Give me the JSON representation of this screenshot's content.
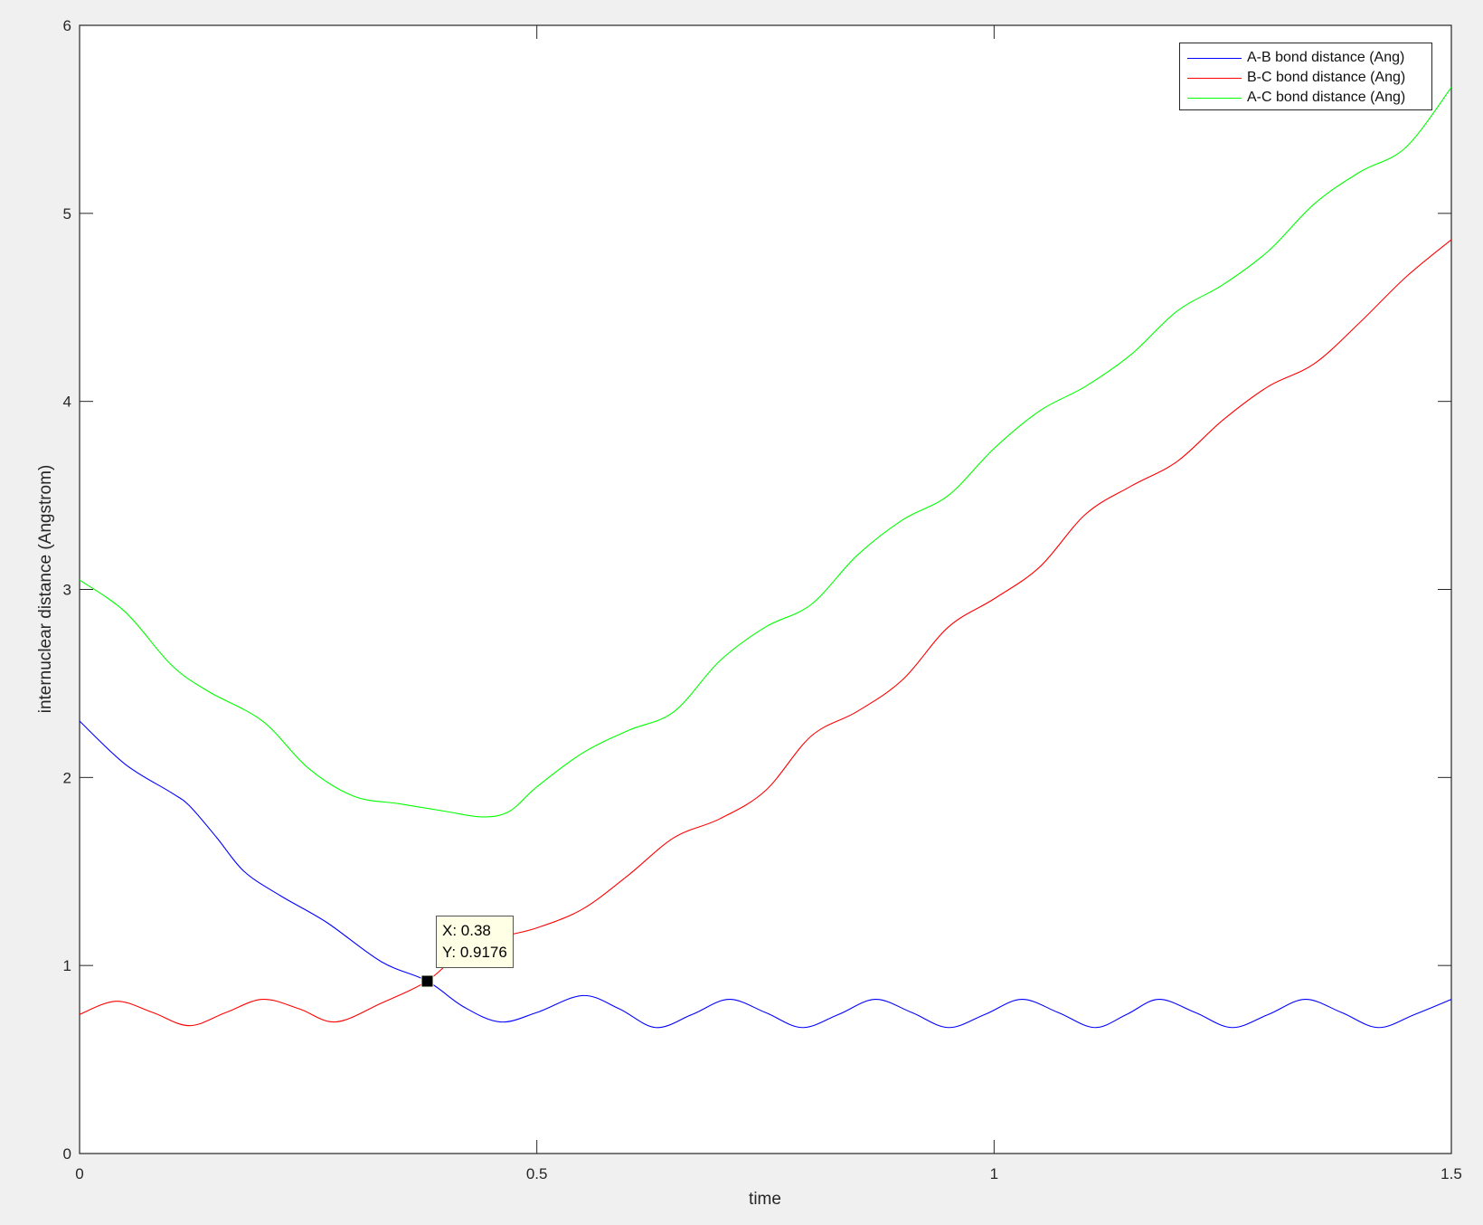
{
  "chart_data": {
    "type": "line",
    "title": "",
    "xlabel": "time",
    "ylabel": "internuclear distance (Angstrom)",
    "xlim": [
      0,
      1.5
    ],
    "ylim": [
      0,
      6
    ],
    "xticks": [
      "0",
      "0.5",
      "1",
      "1.5"
    ],
    "xtick_values": [
      0,
      0.5,
      1,
      1.5
    ],
    "yticks": [
      "0",
      "1",
      "2",
      "3",
      "4",
      "5",
      "6"
    ],
    "ytick_values": [
      0,
      1,
      2,
      3,
      4,
      5,
      6
    ],
    "grid": false,
    "legend_position": "top-right",
    "series": [
      {
        "name": "A-B bond distance (Ang)",
        "color": "#0000ff",
        "x": [
          0,
          0.05,
          0.1,
          0.12,
          0.15,
          0.18,
          0.22,
          0.27,
          0.33,
          0.38,
          0.42,
          0.46,
          0.5,
          0.55,
          0.59,
          0.63,
          0.67,
          0.71,
          0.75,
          0.79,
          0.83,
          0.87,
          0.91,
          0.95,
          0.99,
          1.03,
          1.07,
          1.11,
          1.145,
          1.18,
          1.22,
          1.26,
          1.3,
          1.34,
          1.38,
          1.42,
          1.46,
          1.5
        ],
        "y": [
          2.3,
          2.07,
          1.92,
          1.85,
          1.68,
          1.5,
          1.37,
          1.23,
          1.02,
          0.9176,
          0.78,
          0.7,
          0.75,
          0.84,
          0.77,
          0.67,
          0.74,
          0.82,
          0.75,
          0.67,
          0.74,
          0.82,
          0.75,
          0.67,
          0.74,
          0.82,
          0.75,
          0.67,
          0.74,
          0.82,
          0.75,
          0.67,
          0.74,
          0.82,
          0.75,
          0.67,
          0.74,
          0.82
        ]
      },
      {
        "name": "B-C bond distance (Ang)",
        "color": "#ff0000",
        "x": [
          0,
          0.04,
          0.08,
          0.12,
          0.16,
          0.2,
          0.24,
          0.28,
          0.33,
          0.38,
          0.42,
          0.46,
          0.5,
          0.55,
          0.6,
          0.65,
          0.7,
          0.75,
          0.8,
          0.85,
          0.9,
          0.95,
          1.0,
          1.05,
          1.1,
          1.15,
          1.2,
          1.25,
          1.3,
          1.35,
          1.4,
          1.45,
          1.5
        ],
        "y": [
          0.74,
          0.81,
          0.75,
          0.68,
          0.75,
          0.82,
          0.77,
          0.7,
          0.8,
          0.9176,
          1.08,
          1.15,
          1.2,
          1.3,
          1.48,
          1.68,
          1.78,
          1.93,
          2.22,
          2.35,
          2.52,
          2.8,
          2.95,
          3.12,
          3.4,
          3.55,
          3.68,
          3.9,
          4.08,
          4.2,
          4.42,
          4.66,
          4.86
        ]
      },
      {
        "name": "A-C bond distance (Ang)",
        "color": "#00ff00",
        "x": [
          0,
          0.05,
          0.1,
          0.14,
          0.2,
          0.25,
          0.3,
          0.35,
          0.4,
          0.44,
          0.47,
          0.5,
          0.55,
          0.6,
          0.65,
          0.7,
          0.75,
          0.8,
          0.85,
          0.9,
          0.95,
          1.0,
          1.05,
          1.1,
          1.15,
          1.2,
          1.25,
          1.3,
          1.35,
          1.4,
          1.45,
          1.5
        ],
        "y": [
          3.05,
          2.88,
          2.6,
          2.46,
          2.3,
          2.05,
          1.9,
          1.86,
          1.82,
          1.79,
          1.82,
          1.95,
          2.13,
          2.25,
          2.35,
          2.62,
          2.8,
          2.92,
          3.18,
          3.37,
          3.5,
          3.75,
          3.95,
          4.08,
          4.25,
          4.48,
          4.62,
          4.8,
          5.05,
          5.22,
          5.35,
          5.67
        ]
      }
    ],
    "annotations": [
      {
        "type": "datatip",
        "x": 0.38,
        "y": 0.9176,
        "label_x": "X: 0.38",
        "label_y": "Y: 0.9176"
      }
    ]
  }
}
